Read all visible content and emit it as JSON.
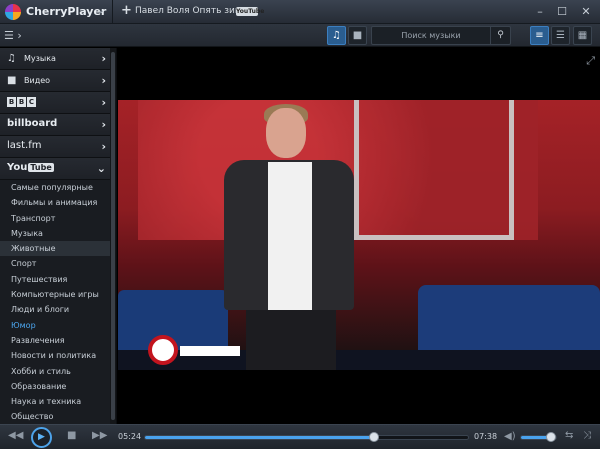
{
  "app": {
    "title": "CherryPlayer"
  },
  "tab": {
    "title": "Павел Воля Опять зима",
    "source_badge": "YouTube"
  },
  "toolbar": {
    "search_placeholder": "Поиск музыки"
  },
  "sidebar": {
    "categories": [
      {
        "label": "Музыка",
        "icon": "music-note-icon"
      },
      {
        "label": "Видео",
        "icon": "video-camera-icon"
      },
      {
        "label": "BBC",
        "icon": "bbc-logo"
      },
      {
        "label": "billboard",
        "icon": "billboard-logo"
      },
      {
        "label": "last.fm",
        "icon": "lastfm-logo"
      },
      {
        "label": "YouTube",
        "icon": "youtube-logo"
      }
    ],
    "youtube_items": [
      "Самые популярные",
      "Фильмы и анимация",
      "Транспорт",
      "Музыка",
      "Животные",
      "Спорт",
      "Путешествия",
      "Компьютерные игры",
      "Люди и блоги",
      "Юмор",
      "Развлечения",
      "Новости и политика",
      "Хобби и стиль",
      "Образование",
      "Наука и техника",
      "Общество"
    ],
    "selected_item": "Животные",
    "active_item": "Юмор"
  },
  "player": {
    "current_time": "05:24",
    "total_time": "07:38",
    "progress": 0.708,
    "volume": 0.85
  },
  "colors": {
    "accent": "#4aa3ee",
    "highlight_text": "#4ca6ef"
  }
}
